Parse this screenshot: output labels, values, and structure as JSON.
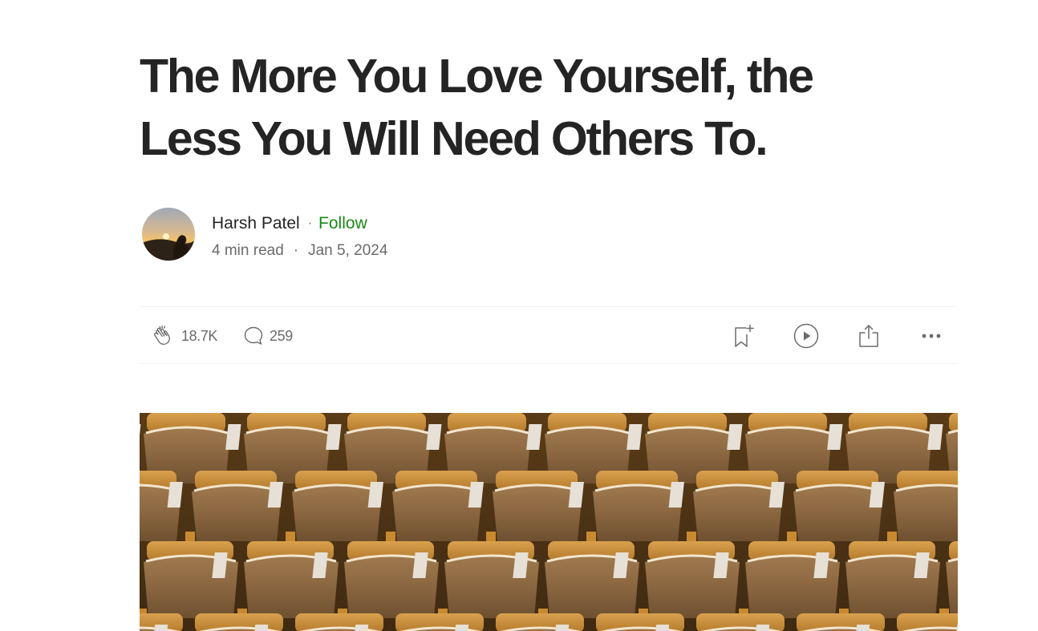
{
  "article": {
    "title": "The More You Love Yourself, the Less You Will Need Others To."
  },
  "author": {
    "name": "Harsh Patel",
    "separator": "·",
    "follow_label": "Follow",
    "avatar_icon": "author-avatar"
  },
  "meta": {
    "read_time": "4 min read",
    "separator": "·",
    "date": "Jan 5, 2024"
  },
  "actions": {
    "claps": {
      "icon": "clap-icon",
      "count": "18.7K"
    },
    "responses": {
      "icon": "comment-icon",
      "count": "259"
    },
    "bookmark": {
      "icon": "bookmark-add-icon"
    },
    "listen": {
      "icon": "play-icon"
    },
    "share": {
      "icon": "share-icon"
    },
    "more": {
      "icon": "more-icon"
    }
  },
  "hero_image": {
    "subject": "rows of auditorium seats"
  },
  "colors": {
    "text": "#242424",
    "muted": "#6b6b6b",
    "follow": "#1a8917",
    "divider": "#f2f2f2"
  }
}
